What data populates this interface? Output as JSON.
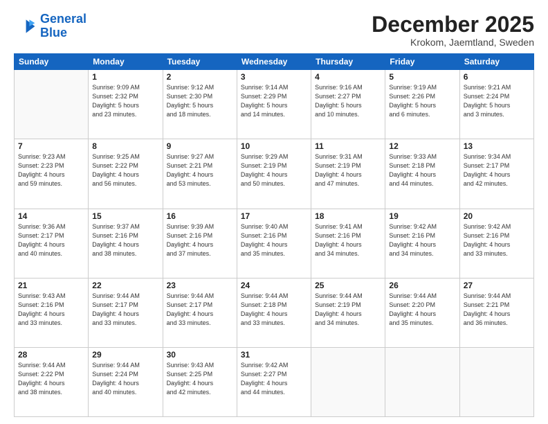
{
  "header": {
    "logo_line1": "General",
    "logo_line2": "Blue",
    "month": "December 2025",
    "location": "Krokom, Jaemtland, Sweden"
  },
  "weekdays": [
    "Sunday",
    "Monday",
    "Tuesday",
    "Wednesday",
    "Thursday",
    "Friday",
    "Saturday"
  ],
  "weeks": [
    [
      {
        "day": "",
        "info": ""
      },
      {
        "day": "1",
        "info": "Sunrise: 9:09 AM\nSunset: 2:32 PM\nDaylight: 5 hours\nand 23 minutes."
      },
      {
        "day": "2",
        "info": "Sunrise: 9:12 AM\nSunset: 2:30 PM\nDaylight: 5 hours\nand 18 minutes."
      },
      {
        "day": "3",
        "info": "Sunrise: 9:14 AM\nSunset: 2:29 PM\nDaylight: 5 hours\nand 14 minutes."
      },
      {
        "day": "4",
        "info": "Sunrise: 9:16 AM\nSunset: 2:27 PM\nDaylight: 5 hours\nand 10 minutes."
      },
      {
        "day": "5",
        "info": "Sunrise: 9:19 AM\nSunset: 2:26 PM\nDaylight: 5 hours\nand 6 minutes."
      },
      {
        "day": "6",
        "info": "Sunrise: 9:21 AM\nSunset: 2:24 PM\nDaylight: 5 hours\nand 3 minutes."
      }
    ],
    [
      {
        "day": "7",
        "info": "Sunrise: 9:23 AM\nSunset: 2:23 PM\nDaylight: 4 hours\nand 59 minutes."
      },
      {
        "day": "8",
        "info": "Sunrise: 9:25 AM\nSunset: 2:22 PM\nDaylight: 4 hours\nand 56 minutes."
      },
      {
        "day": "9",
        "info": "Sunrise: 9:27 AM\nSunset: 2:21 PM\nDaylight: 4 hours\nand 53 minutes."
      },
      {
        "day": "10",
        "info": "Sunrise: 9:29 AM\nSunset: 2:19 PM\nDaylight: 4 hours\nand 50 minutes."
      },
      {
        "day": "11",
        "info": "Sunrise: 9:31 AM\nSunset: 2:19 PM\nDaylight: 4 hours\nand 47 minutes."
      },
      {
        "day": "12",
        "info": "Sunrise: 9:33 AM\nSunset: 2:18 PM\nDaylight: 4 hours\nand 44 minutes."
      },
      {
        "day": "13",
        "info": "Sunrise: 9:34 AM\nSunset: 2:17 PM\nDaylight: 4 hours\nand 42 minutes."
      }
    ],
    [
      {
        "day": "14",
        "info": "Sunrise: 9:36 AM\nSunset: 2:17 PM\nDaylight: 4 hours\nand 40 minutes."
      },
      {
        "day": "15",
        "info": "Sunrise: 9:37 AM\nSunset: 2:16 PM\nDaylight: 4 hours\nand 38 minutes."
      },
      {
        "day": "16",
        "info": "Sunrise: 9:39 AM\nSunset: 2:16 PM\nDaylight: 4 hours\nand 37 minutes."
      },
      {
        "day": "17",
        "info": "Sunrise: 9:40 AM\nSunset: 2:16 PM\nDaylight: 4 hours\nand 35 minutes."
      },
      {
        "day": "18",
        "info": "Sunrise: 9:41 AM\nSunset: 2:16 PM\nDaylight: 4 hours\nand 34 minutes."
      },
      {
        "day": "19",
        "info": "Sunrise: 9:42 AM\nSunset: 2:16 PM\nDaylight: 4 hours\nand 34 minutes."
      },
      {
        "day": "20",
        "info": "Sunrise: 9:42 AM\nSunset: 2:16 PM\nDaylight: 4 hours\nand 33 minutes."
      }
    ],
    [
      {
        "day": "21",
        "info": "Sunrise: 9:43 AM\nSunset: 2:16 PM\nDaylight: 4 hours\nand 33 minutes."
      },
      {
        "day": "22",
        "info": "Sunrise: 9:44 AM\nSunset: 2:17 PM\nDaylight: 4 hours\nand 33 minutes."
      },
      {
        "day": "23",
        "info": "Sunrise: 9:44 AM\nSunset: 2:17 PM\nDaylight: 4 hours\nand 33 minutes."
      },
      {
        "day": "24",
        "info": "Sunrise: 9:44 AM\nSunset: 2:18 PM\nDaylight: 4 hours\nand 33 minutes."
      },
      {
        "day": "25",
        "info": "Sunrise: 9:44 AM\nSunset: 2:19 PM\nDaylight: 4 hours\nand 34 minutes."
      },
      {
        "day": "26",
        "info": "Sunrise: 9:44 AM\nSunset: 2:20 PM\nDaylight: 4 hours\nand 35 minutes."
      },
      {
        "day": "27",
        "info": "Sunrise: 9:44 AM\nSunset: 2:21 PM\nDaylight: 4 hours\nand 36 minutes."
      }
    ],
    [
      {
        "day": "28",
        "info": "Sunrise: 9:44 AM\nSunset: 2:22 PM\nDaylight: 4 hours\nand 38 minutes."
      },
      {
        "day": "29",
        "info": "Sunrise: 9:44 AM\nSunset: 2:24 PM\nDaylight: 4 hours\nand 40 minutes."
      },
      {
        "day": "30",
        "info": "Sunrise: 9:43 AM\nSunset: 2:25 PM\nDaylight: 4 hours\nand 42 minutes."
      },
      {
        "day": "31",
        "info": "Sunrise: 9:42 AM\nSunset: 2:27 PM\nDaylight: 4 hours\nand 44 minutes."
      },
      {
        "day": "",
        "info": ""
      },
      {
        "day": "",
        "info": ""
      },
      {
        "day": "",
        "info": ""
      }
    ]
  ]
}
